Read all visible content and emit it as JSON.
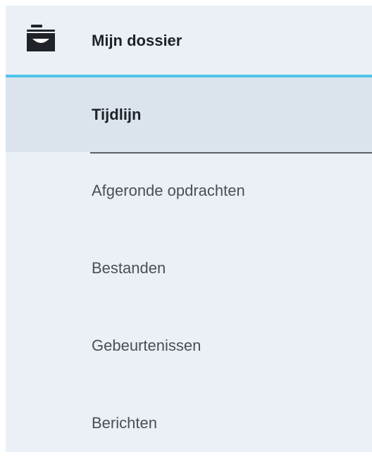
{
  "header": {
    "title": "Mijn dossier",
    "icon": "folder-icon"
  },
  "colors": {
    "panel_bg": "#eaf0f6",
    "active_bg": "#dbe4ec",
    "accent": "#4fc3ea",
    "text_strong": "#1f2329",
    "text_muted": "#4a4f56"
  },
  "nav": {
    "items": [
      {
        "label": "Tijdlijn",
        "active": true
      },
      {
        "label": "Afgeronde opdrachten",
        "active": false
      },
      {
        "label": "Bestanden",
        "active": false
      },
      {
        "label": "Gebeurtenissen",
        "active": false
      },
      {
        "label": "Berichten",
        "active": false
      }
    ]
  }
}
